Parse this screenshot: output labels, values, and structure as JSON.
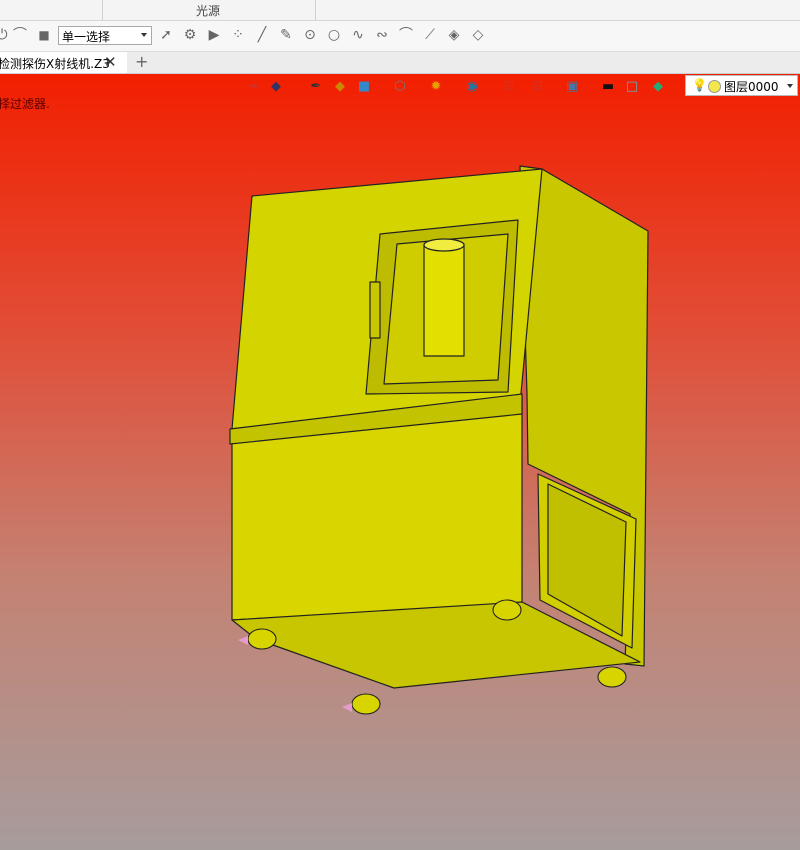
{
  "ribbon": {
    "group_label": "光源"
  },
  "toolbar": {
    "selection_mode": "单一选择",
    "icons": [
      "power-icon",
      "filter-icon",
      "stop-icon",
      "arrow-select-icon",
      "gear-select-icon",
      "play-icon",
      "dots-icon",
      "line-icon",
      "pen-icon",
      "circle-dot-icon",
      "circle-icon",
      "wave-icon",
      "curve-icon",
      "arc-icon",
      "slash-icon",
      "stack-icon",
      "stack2-icon"
    ]
  },
  "tabs": {
    "active_title": "检测探伤X射线机.Z3",
    "close_label": "✕",
    "add_label": "+"
  },
  "viewport": {
    "filter_message": "择过滤器.",
    "layer_name": "图层0000",
    "background_top": "#f21f00",
    "background_bottom": "#a79c9c",
    "model_color": "#d4d400"
  }
}
